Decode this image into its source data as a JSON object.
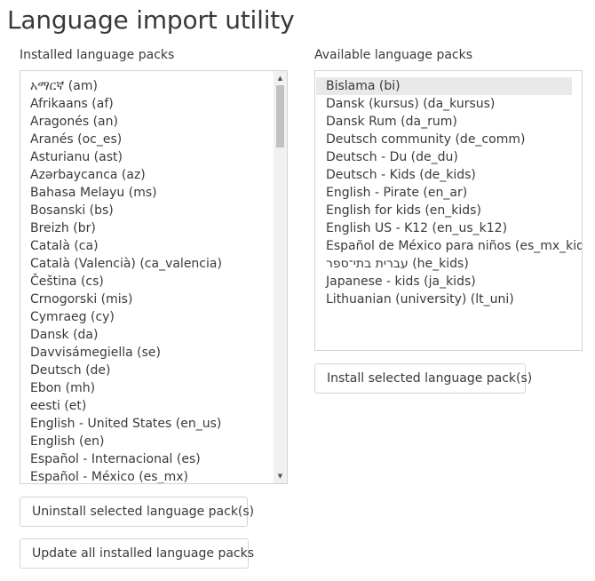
{
  "page": {
    "title": "Language import utility"
  },
  "installed": {
    "label": "Installed language packs",
    "items": [
      "አማርኛ (am)",
      "Afrikaans (af)",
      "Aragonés (an)",
      "Aranés (oc_es)",
      "Asturianu (ast)",
      "Azərbaycanca (az)",
      "Bahasa Melayu (ms)",
      "Bosanski (bs)",
      "Breizh (br)",
      "Català (ca)",
      "Català (Valencià) (ca_valencia)",
      "Čeština (cs)",
      "Crnogorski (mis)",
      "Cymraeg (cy)",
      "Dansk (da)",
      "Davvisámegiella (se)",
      "Deutsch (de)",
      "Ebon (mh)",
      "eesti (et)",
      "English - United States (en_us)",
      "English (en)",
      "Español - Internacional (es)",
      "Español - México (es_mx)"
    ],
    "scroll_up_icon": "triangle-up",
    "scroll_down_icon": "triangle-down"
  },
  "available": {
    "label": "Available language packs",
    "selected_index": 0,
    "items": [
      "Bislama (bi)",
      "Dansk (kursus) (da_kursus)",
      "Dansk Rum (da_rum)",
      "Deutsch community (de_comm)",
      "Deutsch - Du (de_du)",
      "Deutsch - Kids (de_kids)",
      "English - Pirate (en_ar)",
      "English for kids (en_kids)",
      "English US - K12 (en_us_k12)",
      "Español de México para niños (es_mx_kids)",
      "עברית בתי־ספר (he_kids)",
      "Japanese - kids (ja_kids)",
      "Lithuanian (university) (lt_uni)"
    ]
  },
  "buttons": {
    "install": "Install selected language pack(s)",
    "uninstall": "Uninstall selected language pack(s)",
    "update": "Update all installed language packs"
  }
}
